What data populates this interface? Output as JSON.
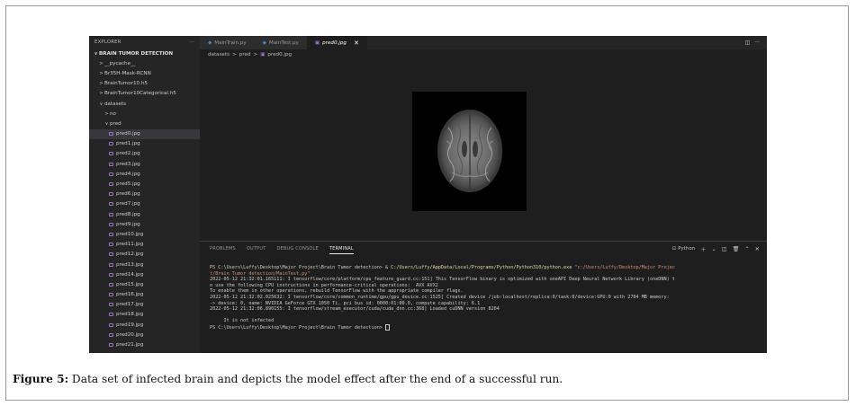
{
  "sidebar": {
    "title": "EXPLORER",
    "more": "···",
    "items": [
      {
        "label": "BRAIN TUMOR DETECTION",
        "depth": 0,
        "twisty": "∨",
        "kind": "root"
      },
      {
        "label": "__pycache__",
        "depth": 1,
        "twisty": ">",
        "kind": "folder"
      },
      {
        "label": "Br35H-Mask-RCNN",
        "depth": 1,
        "twisty": ">",
        "kind": "folder"
      },
      {
        "label": "BrainTumor10.h5",
        "depth": 1,
        "twisty": ">",
        "kind": "folder"
      },
      {
        "label": "BrainTumor10Categorical.h5",
        "depth": 1,
        "twisty": ">",
        "kind": "folder"
      },
      {
        "label": "datasets",
        "depth": 1,
        "twisty": "∨",
        "kind": "folder"
      },
      {
        "label": "no",
        "depth": 2,
        "twisty": ">",
        "kind": "folder"
      },
      {
        "label": "pred",
        "depth": 2,
        "twisty": "∨",
        "kind": "folder"
      },
      {
        "label": "pred0.jpg",
        "depth": 3,
        "kind": "file",
        "selected": true
      },
      {
        "label": "pred1.jpg",
        "depth": 3,
        "kind": "file"
      },
      {
        "label": "pred2.jpg",
        "depth": 3,
        "kind": "file"
      },
      {
        "label": "pred3.jpg",
        "depth": 3,
        "kind": "file"
      },
      {
        "label": "pred4.jpg",
        "depth": 3,
        "kind": "file"
      },
      {
        "label": "pred5.jpg",
        "depth": 3,
        "kind": "file"
      },
      {
        "label": "pred6.jpg",
        "depth": 3,
        "kind": "file"
      },
      {
        "label": "pred7.jpg",
        "depth": 3,
        "kind": "file"
      },
      {
        "label": "pred8.jpg",
        "depth": 3,
        "kind": "file"
      },
      {
        "label": "pred9.jpg",
        "depth": 3,
        "kind": "file"
      },
      {
        "label": "pred10.jpg",
        "depth": 3,
        "kind": "file"
      },
      {
        "label": "pred11.jpg",
        "depth": 3,
        "kind": "file"
      },
      {
        "label": "pred12.jpg",
        "depth": 3,
        "kind": "file"
      },
      {
        "label": "pred13.jpg",
        "depth": 3,
        "kind": "file"
      },
      {
        "label": "pred14.jpg",
        "depth": 3,
        "kind": "file"
      },
      {
        "label": "pred15.jpg",
        "depth": 3,
        "kind": "file"
      },
      {
        "label": "pred16.jpg",
        "depth": 3,
        "kind": "file"
      },
      {
        "label": "pred17.jpg",
        "depth": 3,
        "kind": "file"
      },
      {
        "label": "pred18.jpg",
        "depth": 3,
        "kind": "file"
      },
      {
        "label": "pred19.jpg",
        "depth": 3,
        "kind": "file"
      },
      {
        "label": "pred20.jpg",
        "depth": 3,
        "kind": "file"
      },
      {
        "label": "pred21.jpg",
        "depth": 3,
        "kind": "file"
      }
    ]
  },
  "tabs": [
    {
      "label": "MainTrain.py",
      "icon": "python-icon",
      "active": false
    },
    {
      "label": "MainTest.py",
      "icon": "python-icon",
      "active": false
    },
    {
      "label": "pred0.jpg",
      "icon": "image-icon",
      "active": true
    }
  ],
  "breadcrumb": {
    "part1": "datasets",
    "part2": "pred",
    "part3": "pred0.jpg",
    "sep": ">"
  },
  "panel": {
    "tabs": [
      {
        "label": "PROBLEMS",
        "active": false
      },
      {
        "label": "OUTPUT",
        "active": false
      },
      {
        "label": "DEBUG CONSOLE",
        "active": false
      },
      {
        "label": "TERMINAL",
        "active": true
      }
    ],
    "shell": "Python",
    "terminal": {
      "l1a": "PS C:\\Users\\Luffy\\Desktop\\Major Project\\Brain Tumor detection> & ",
      "l1b": "C:/Users/Luffy/AppData/Local/Programs/Python/Python310/python.exe",
      "l1c": " \"c:/Users/Luffy/Desktop/Major Projec",
      "l2": "t/Brain Tumor detection/MainTest.py\"",
      "l3": "2022-05-12 21:32:01.165111: I tensorflow/core/platform/cpu_feature_guard.cc:151] This TensorFlow binary is optimized with oneAPI Deep Neural Network Library (oneDNN) t",
      "l4": "o use the following CPU instructions in performance-critical operations:  AVX AVX2",
      "l5": "To enable them in other operations, rebuild TensorFlow with the appropriate compiler flags.",
      "l6": "2022-05-12 21:32:02.025632: I tensorflow/core/common_runtime/gpu/gpu_device.cc:1525] Created device /job:localhost/replica:0/task:0/device:GPU:0 with 2784 MB memory:",
      "l7": "-> device: 0, name: NVIDIA GeForce GTX 1050 Ti, pci bus id: 0000:01:00.0, compute capability: 6.1",
      "l8": "2022-05-12 21:32:06.890155: I tensorflow/stream_executor/cuda/cuda_dnn.cc:368] Loaded cuDNN version 8204",
      "l9": "",
      "l10": "     It is not infected",
      "l11": "PS C:\\Users\\Luffy\\Desktop\\Major Project\\Brain Tumor detection> "
    }
  },
  "caption": {
    "label": "Figure 5:",
    "text": " Data set of infected brain and depicts the model effect after the end of a successful run."
  },
  "colors": {
    "editor_bg": "#1e1e1e",
    "sidebar_bg": "#252526",
    "string": "#ce9178",
    "path": "#dcdcaa"
  }
}
